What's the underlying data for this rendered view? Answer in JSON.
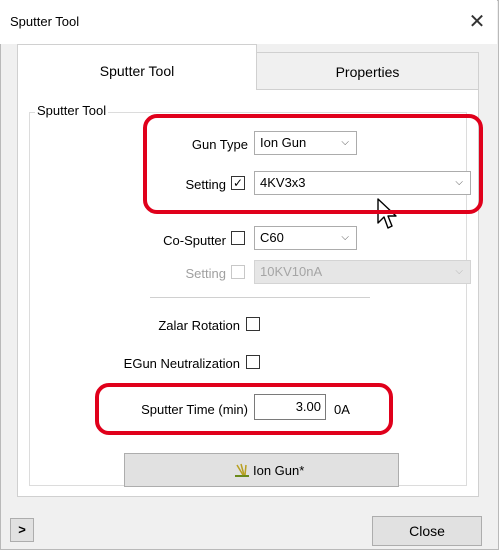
{
  "window": {
    "title": "Sputter Tool",
    "close_glyph": "✕"
  },
  "tabs": [
    {
      "label": "Sputter Tool",
      "active": true
    },
    {
      "label": "Properties",
      "active": false
    }
  ],
  "group": {
    "label": "Sputter Tool"
  },
  "gun_type": {
    "label": "Gun Type",
    "value": "Ion Gun"
  },
  "setting": {
    "label": "Setting",
    "checked": true,
    "value": "4KV3x3"
  },
  "co_sputter": {
    "label": "Co-Sputter",
    "checked": false,
    "value": "C60"
  },
  "co_setting": {
    "label": "Setting",
    "checked": false,
    "value": "10KV10nA",
    "disabled": true
  },
  "zalar": {
    "label": "Zalar Rotation",
    "checked": false
  },
  "egun": {
    "label": "EGun Neutralization",
    "checked": false
  },
  "sputter_time": {
    "label": "Sputter Time (min)",
    "value": "3.00",
    "unit": "0A"
  },
  "ion_gun_button": {
    "label": "Ion Gun*"
  },
  "footer": {
    "expand_glyph": ">",
    "close_label": "Close"
  },
  "icons": {
    "dropdown": "chevron-down-icon",
    "cursor": "mouse-pointer-icon",
    "ion_gun": "ion-gun-icon"
  },
  "colors": {
    "highlight": "#e0001b"
  }
}
